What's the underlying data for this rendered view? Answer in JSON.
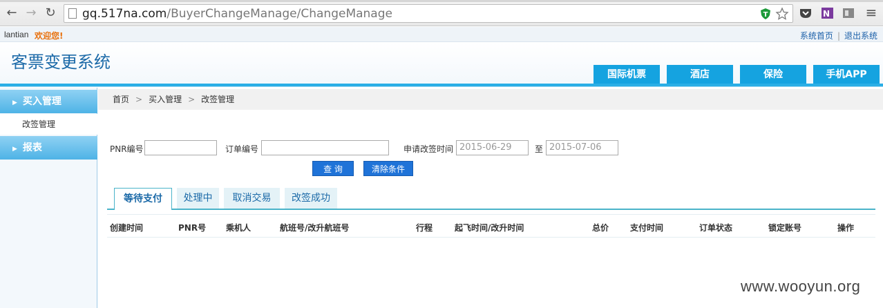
{
  "browser": {
    "url_host": "gq.517na.com",
    "url_path": "/BuyerChangeManage/ChangeManage",
    "icons": [
      "back-icon",
      "forward-icon",
      "reload-icon",
      "page-icon",
      "shield-extension-icon",
      "star-icon",
      "pocket-icon",
      "onenote-icon",
      "extension-icon",
      "menu-icon"
    ]
  },
  "topbar": {
    "user": "lantian",
    "welcome": "欢迎您!",
    "link_home": "系统首页",
    "link_sep": "|",
    "link_logout": "退出系统"
  },
  "header": {
    "title": "客票变更系统",
    "nav": [
      "国际机票",
      "酒店",
      "保险",
      "手机APP"
    ]
  },
  "sidebar": {
    "groups": [
      {
        "label": "买入管理",
        "items": [
          "改签管理"
        ]
      },
      {
        "label": "报表",
        "items": []
      }
    ]
  },
  "breadcrumb": {
    "items": [
      "首页",
      "买入管理",
      "改签管理"
    ],
    "separator": ">"
  },
  "search": {
    "pnr_label": "PNR编号",
    "pnr_value": "",
    "order_label": "订单编号",
    "order_value": "",
    "date_label": "申请改签时间",
    "date_from": "2015-06-29",
    "date_to_label": "至",
    "date_to": "2015-07-06",
    "query_button": "查 询",
    "clear_button": "清除条件"
  },
  "status_tabs": [
    "等待支付",
    "处理中",
    "取消交易",
    "改签成功"
  ],
  "active_tab": 0,
  "table": {
    "columns": [
      "创建时间",
      "PNR号",
      "乘机人",
      "航班号/改升航班号",
      "行程",
      "起飞时间/改升时间",
      "总价",
      "支付时间",
      "订单状态",
      "锁定账号",
      "操作"
    ],
    "rows": []
  },
  "watermark": "www.wooyun.org",
  "colors": {
    "accent": "#15a3e0",
    "title": "#1c6aa8",
    "welcome": "#e8700c",
    "button": "#1f73d8"
  }
}
